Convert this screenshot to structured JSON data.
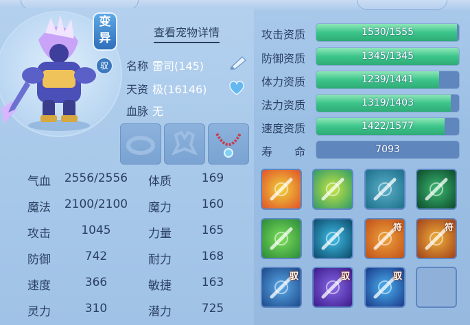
{
  "header": {
    "detail_link": "查看宠物详情"
  },
  "pet": {
    "variant_badge": "变异",
    "tamed_badge": "驭",
    "name_label": "名称",
    "name_value": "雷司(145)",
    "talent_label": "天资",
    "talent_value": "极(16146)",
    "blood_label": "血脉",
    "blood_value": "无"
  },
  "stats_left": [
    {
      "label": "气血",
      "value": "2556/2556"
    },
    {
      "label": "魔法",
      "value": "2100/2100"
    },
    {
      "label": "攻击",
      "value": "1045"
    },
    {
      "label": "防御",
      "value": "742"
    },
    {
      "label": "速度",
      "value": "366"
    },
    {
      "label": "灵力",
      "value": "310"
    }
  ],
  "stats_right": [
    {
      "label": "体质",
      "value": "169"
    },
    {
      "label": "魔力",
      "value": "160"
    },
    {
      "label": "力量",
      "value": "165"
    },
    {
      "label": "耐力",
      "value": "168"
    },
    {
      "label": "敏捷",
      "value": "163"
    },
    {
      "label": "潜力",
      "value": "725"
    }
  ],
  "aptitudes": [
    {
      "label": "攻击资质",
      "text": "1530/1555",
      "ratio": 0.984
    },
    {
      "label": "防御资质",
      "text": "1345/1345",
      "ratio": 1.0
    },
    {
      "label": "体力资质",
      "text": "1239/1441",
      "ratio": 0.86
    },
    {
      "label": "法力资质",
      "text": "1319/1403",
      "ratio": 0.94
    },
    {
      "label": "速度资质",
      "text": "1422/1577",
      "ratio": 0.9
    },
    {
      "label": "寿　　命",
      "text": "7093",
      "ratio": 0
    }
  ],
  "skills": [
    {
      "icon": "sword-slash-skill-icon",
      "tag": ""
    },
    {
      "icon": "poison-whirl-skill-icon",
      "tag": ""
    },
    {
      "icon": "shadow-figure-skill-icon",
      "tag": ""
    },
    {
      "icon": "dark-claw-skill-icon",
      "tag": ""
    },
    {
      "icon": "heart-shield-skill-icon",
      "tag": ""
    },
    {
      "icon": "blue-flame-skill-icon",
      "tag": ""
    },
    {
      "icon": "wing-talisman-skill-icon",
      "tag": "符"
    },
    {
      "icon": "boot-talisman-skill-icon",
      "tag": "符"
    },
    {
      "icon": "beast-orb-skill-icon",
      "tag": "驭"
    },
    {
      "icon": "purple-fist-skill-icon",
      "tag": "驭"
    },
    {
      "icon": "blue-dash-skill-icon",
      "tag": "驭"
    },
    {
      "icon": "empty-skill-slot",
      "tag": ""
    }
  ],
  "colors": {
    "bar_fill": "#3cc58a",
    "panel": "#a9c9ea",
    "text": "#2a3f62"
  }
}
